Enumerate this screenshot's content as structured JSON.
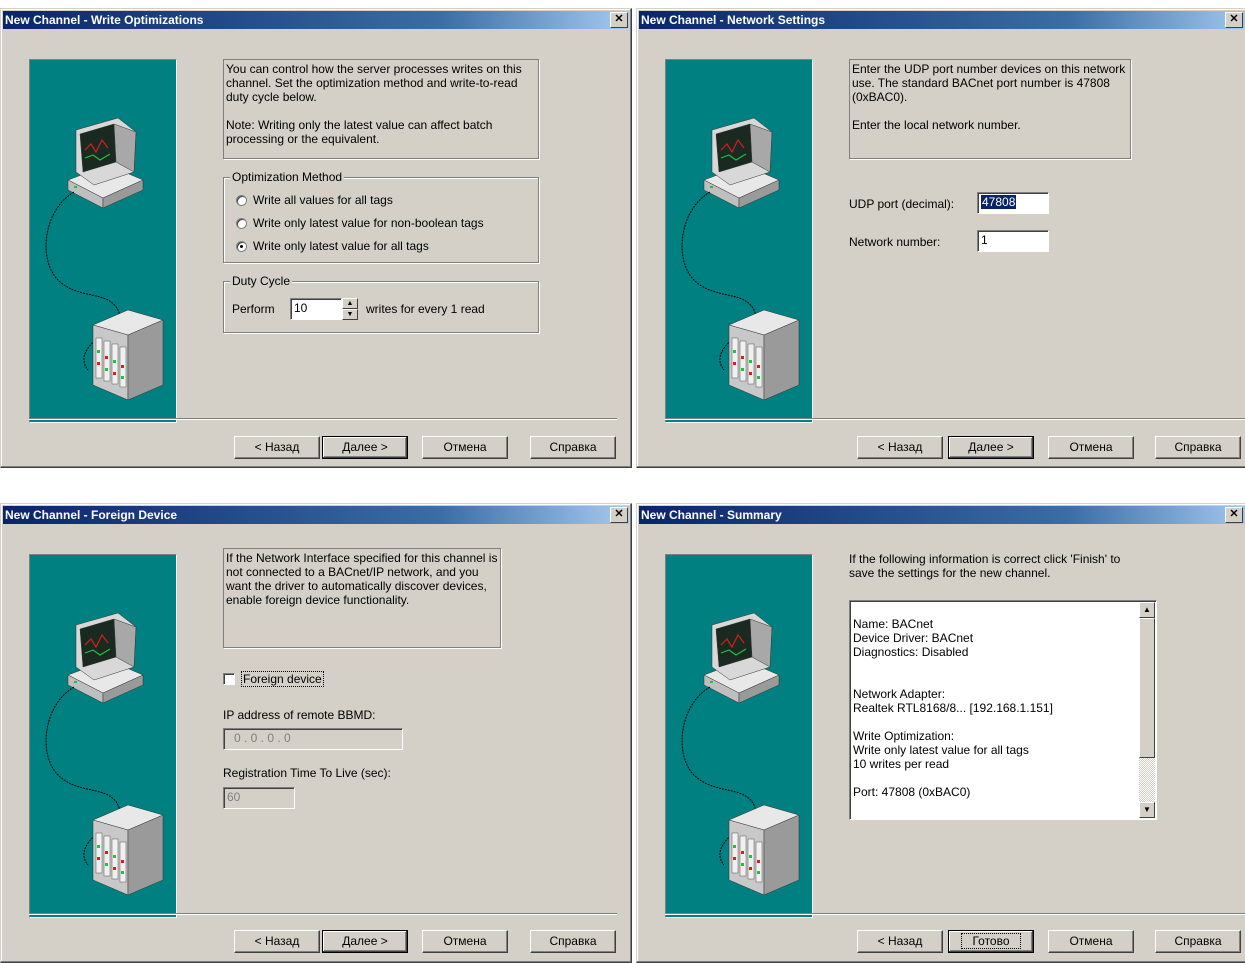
{
  "buttons": {
    "back": "< Назад",
    "next": "Далее >",
    "cancel": "Отмена",
    "help": "Справка",
    "finish": "Готово"
  },
  "close_glyph": "✕",
  "icons": {
    "illustration": "computer-plc-network-icon",
    "close": "close-icon"
  },
  "colors": {
    "title_bar": "#0a246a",
    "art_bg": "#008080",
    "dialog_bg": "#d4d0c8"
  },
  "write_opt": {
    "title": "New Channel - Write Optimizations",
    "description": "You can control how the server processes writes on this channel.  Set the optimization method and write-to-read duty cycle below.\n\nNote:  Writing only the latest value can affect batch processing or the equivalent.",
    "method_group": "Optimization Method",
    "options": [
      "Write all values for all tags",
      "Write only latest value for non-boolean tags",
      "Write only latest value for all tags"
    ],
    "selected_index": 2,
    "duty_group": "Duty Cycle",
    "perform_label": "Perform",
    "perform_value": "10",
    "writes_suffix": "writes for every 1 read"
  },
  "network": {
    "title": "New Channel - Network Settings",
    "description": "Enter the UDP port number devices on this network use. The standard BACnet port number is 47808 (0xBAC0).\n\nEnter the local network number.",
    "udp_label": "UDP port (decimal):",
    "udp_value": "47808",
    "netnum_label": "Network number:",
    "netnum_value": "1"
  },
  "foreign": {
    "title": "New Channel - Foreign Device",
    "description": "If the Network Interface specified for this channel is not connected to a BACnet/IP network, and you want the driver to automatically discover devices, enable foreign device functionality.",
    "checkbox_label": "Foreign device",
    "checked": false,
    "ip_label": "IP address of remote BBMD:",
    "ip_value": "0  .  0  .  0  .  0",
    "ttl_label": "Registration Time To Live (sec):",
    "ttl_value": "60"
  },
  "summary": {
    "title": "New Channel - Summary",
    "description": "If the following information is correct click 'Finish' to save the settings for the new channel.",
    "details": "Name: BACnet\nDevice Driver: BACnet\nDiagnostics: Disabled\n\n\nNetwork Adapter:\nRealtek RTL8168/8... [192.168.1.151]\n\nWrite Optimization:\nWrite only latest value for all tags\n10 writes per read\n\nPort: 47808 (0xBAC0)"
  }
}
